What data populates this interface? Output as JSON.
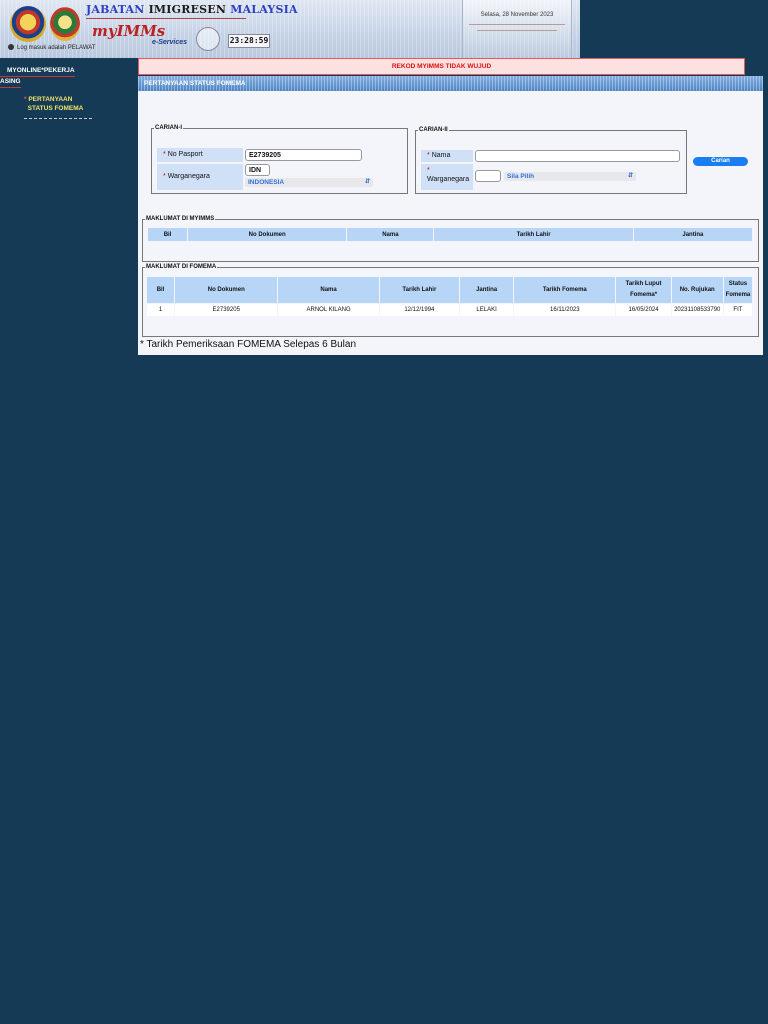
{
  "header": {
    "agency_parts": [
      "JABATAN",
      "IMIGRESEN",
      "MALAYSIA"
    ],
    "app_name": "myIMMs",
    "app_sub": "e-Services",
    "login_note": "Log masuk adalah PELAWAT",
    "clock": "23:28:59",
    "date": "Selasa, 28 November 2023"
  },
  "sidebar": {
    "heading_line1": "MYONLINE*PEKERJA",
    "heading_line2": "ASING",
    "item_star": "*",
    "item_line1": "PERTANYAAN",
    "item_line2": "STATUS FOMEMA"
  },
  "alert": "REKOD MYIMMS TIDAK WUJUD",
  "main": {
    "title": "PERTANYAAN STATUS FOMEMA",
    "carian1": {
      "legend": "CARIAN-I",
      "req": "*",
      "passport_label": "No Pasport",
      "passport_value": "E2739205",
      "nationality_label": "Warganegara",
      "nationality_code": "IDN",
      "nationality_select": "INDONESIA"
    },
    "carian2": {
      "legend": "CARIAN-II",
      "req": "*",
      "name_label": "Nama",
      "name_value": "",
      "nationality_label": "Warganegara",
      "nationality_code": "",
      "nationality_select": "Sila Pilih"
    },
    "search_button": "Carian",
    "myimms": {
      "legend": "MAKLUMAT DI MYIMMS",
      "headers": [
        "Bil",
        "No Dokumen",
        "Nama",
        "Tarikh Lahir",
        "Jantina"
      ]
    },
    "fomema": {
      "legend": "MAKLUMAT DI FOMEMA",
      "headers": [
        "Bil",
        "No Dokumen",
        "Nama",
        "Tarikh Lahir",
        "Jantina",
        "Tarikh Fomema",
        "Tarikh Luput Fomema*",
        "No. Rujukan",
        "Status Fomema"
      ],
      "rows": [
        [
          "1",
          "E2739205",
          "ARNOL KILANG",
          "12/12/1994",
          "LELAKI",
          "16/11/2023",
          "16/05/2024",
          "20231108533790",
          "FIT"
        ]
      ]
    },
    "footnote": "* Tarikh Pemeriksaan FOMEMA Selepas 6 Bulan"
  },
  "colors": {
    "page_bg": "#143a55",
    "accent_blue": "#1a7ef0",
    "alert_red": "#d11"
  }
}
